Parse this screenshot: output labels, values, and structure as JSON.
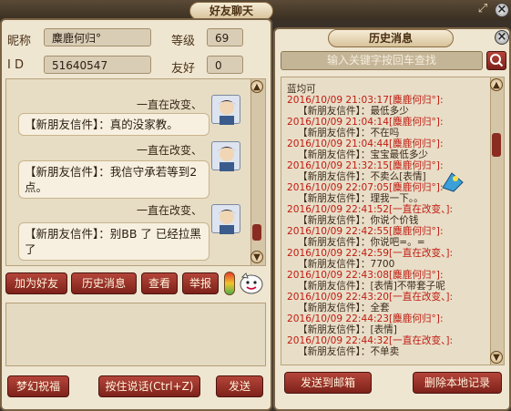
{
  "chat_window": {
    "title": "好友聊天",
    "nickname_label": "昵称",
    "nickname": "麋鹿何归°",
    "level_label": "等级",
    "level": "69",
    "id_label": "I D",
    "id": "51640547",
    "friendship_label": "友好",
    "friendship": "0",
    "messages": [
      {
        "sender": "一直在改变、",
        "text": "【新朋友信件】：真的没家教。"
      },
      {
        "sender": "一直在改变、",
        "text": "【新朋友信件】：我信守承若等到2点。"
      },
      {
        "sender": "一直在改变、",
        "text": "【新朋友信件】：别BB 了 已经拉黑了"
      }
    ],
    "buttons": {
      "add_friend": "加为好友",
      "history": "历史消息",
      "view": "查看",
      "report": "举报",
      "dream_blessing": "梦幻祝福",
      "voice": "按住说话(Ctrl+Z)",
      "send": "发送"
    }
  },
  "history_window": {
    "title": "历史消息",
    "search_placeholder": "输入关键字按回车查找",
    "lines": [
      {
        "t": "蓝均可",
        "c": "blk"
      },
      {
        "t": "2016/10/09 21:03:17[麋鹿何归°]:",
        "c": "red"
      },
      {
        "t": "【新朋友信件】：最低多少",
        "c": "blk"
      },
      {
        "t": "2016/10/09 21:04:14[麋鹿何归°]:",
        "c": "red"
      },
      {
        "t": "【新朋友信件】：不在吗",
        "c": "blk"
      },
      {
        "t": "2016/10/09 21:04:44[麋鹿何归°]:",
        "c": "red"
      },
      {
        "t": "【新朋友信件】：宝宝最低多少",
        "c": "blk"
      },
      {
        "t": "2016/10/09 21:32:15[麋鹿何归°]:",
        "c": "red"
      },
      {
        "t": "【新朋友信件】：不卖么[表情]",
        "c": "blk"
      },
      {
        "t": "2016/10/09 22:07:05[麋鹿何归°]:",
        "c": "red"
      },
      {
        "t": "【新朋友信件】：理我一下。。",
        "c": "blk"
      },
      {
        "t": "2016/10/09 22:41:52[一直在改变、]:",
        "c": "red"
      },
      {
        "t": "【新朋友信件】：你说个价钱",
        "c": "blk"
      },
      {
        "t": "2016/10/09 22:42:55[麋鹿何归°]:",
        "c": "red"
      },
      {
        "t": "【新朋友信件】：你说吧=。=",
        "c": "blk"
      },
      {
        "t": "2016/10/09 22:42:59[一直在改变、]:",
        "c": "red"
      },
      {
        "t": "【新朋友信件】：7700",
        "c": "blk"
      },
      {
        "t": "2016/10/09 22:43:08[麋鹿何归°]:",
        "c": "red"
      },
      {
        "t": "【新朋友信件】：[表情]不带套子呢",
        "c": "blk"
      },
      {
        "t": "2016/10/09 22:43:20[一直在改变、]:",
        "c": "red"
      },
      {
        "t": "【新朋友信件】：全套",
        "c": "blk"
      },
      {
        "t": "2016/10/09 22:44:23[麋鹿何归°]:",
        "c": "red"
      },
      {
        "t": "【新朋友信件】：[表情]",
        "c": "blk"
      },
      {
        "t": "2016/10/09 22:44:32[一直在改变、]:",
        "c": "red"
      },
      {
        "t": "【新朋友信件】：不单卖",
        "c": "blk"
      }
    ],
    "buttons": {
      "send_mail": "发送到邮箱",
      "delete_local": "删除本地记录"
    }
  }
}
